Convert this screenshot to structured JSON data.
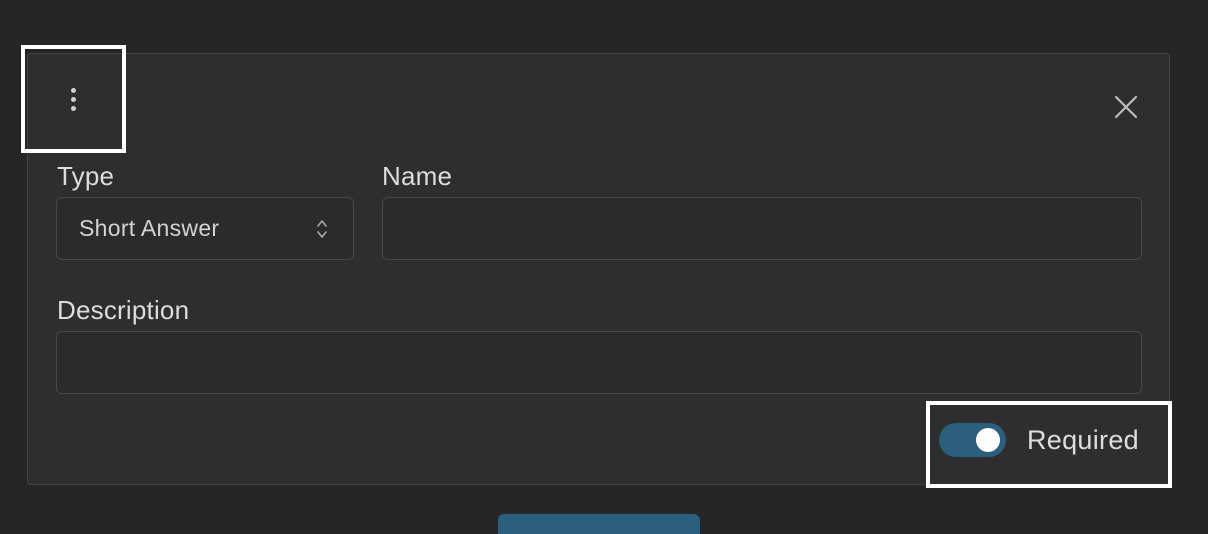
{
  "dialog": {
    "menu_icon": "kebab-menu-icon",
    "close_icon": "close-icon",
    "type": {
      "label": "Type",
      "selected": "Short Answer",
      "icon": "updown-chevron-icon"
    },
    "name": {
      "label": "Name",
      "value": ""
    },
    "description": {
      "label": "Description",
      "value": ""
    },
    "required": {
      "label": "Required",
      "on": true
    }
  },
  "colors": {
    "background": "#262626",
    "card": "#2e2e2e",
    "toggle_on": "#2a5f7f",
    "highlight": "#ffffff"
  }
}
